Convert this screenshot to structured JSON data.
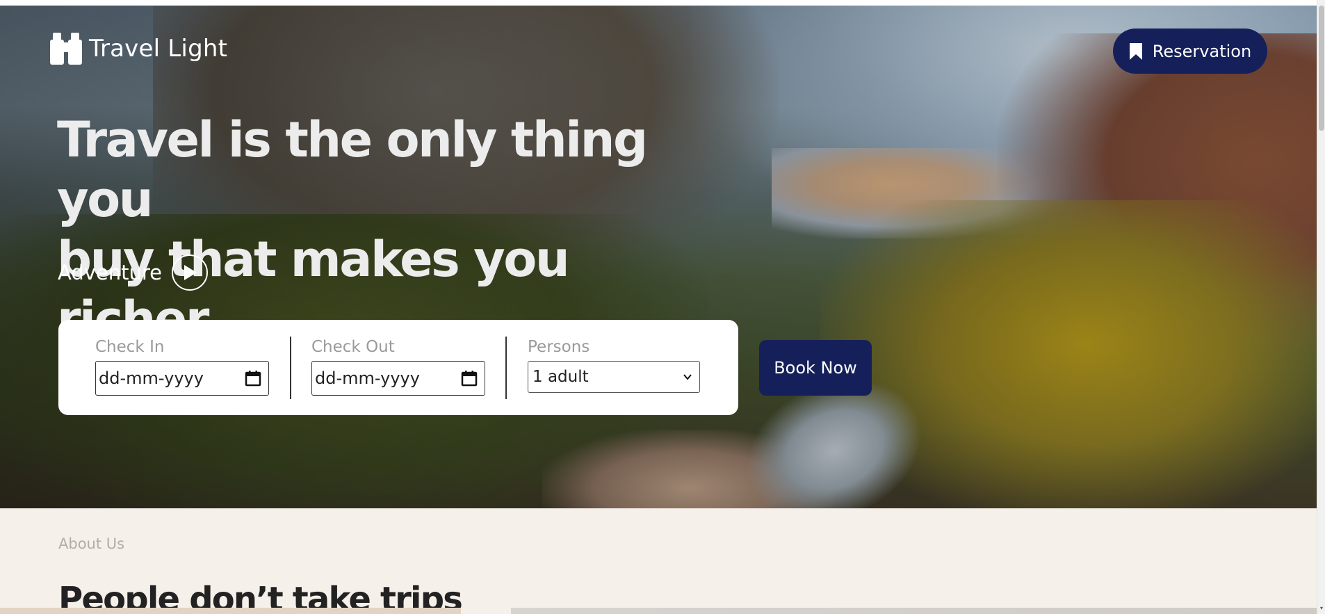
{
  "header": {
    "logo_text": "Travel Light",
    "logo_icon": "binoculars-icon",
    "reservation_label": "Reservation",
    "reservation_icon": "bookmark-icon"
  },
  "hero": {
    "headline_line1": "Travel is the only thing you",
    "headline_line2": "buy that makes you richer",
    "adventure_label": "Adventure",
    "adventure_icon": "play-icon"
  },
  "booking": {
    "check_in_label": "Check In",
    "check_in_value": "dd-mm-yyyy",
    "check_out_label": "Check Out",
    "check_out_value": "dd-mm-yyyy",
    "persons_label": "Persons",
    "persons_value": "1 adult",
    "book_now_label": "Book Now"
  },
  "about": {
    "label": "About Us",
    "heading": "People don’t take trips"
  },
  "colors": {
    "primary_navy": "#15205a",
    "section_bg": "#f5f0ea"
  }
}
